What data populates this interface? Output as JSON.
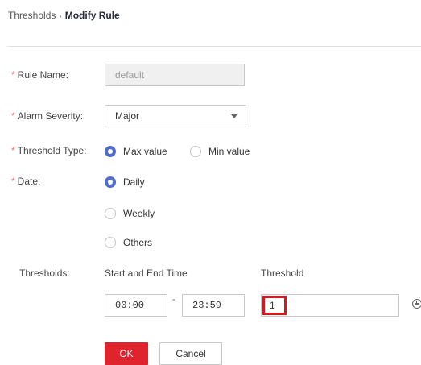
{
  "breadcrumb": {
    "parent": "Thresholds",
    "separator": "›",
    "current": "Modify Rule"
  },
  "form": {
    "rule_name": {
      "label": "Rule Name:",
      "value": "default"
    },
    "alarm_severity": {
      "label": "Alarm Severity:",
      "value": "Major"
    },
    "threshold_type": {
      "label": "Threshold Type:",
      "options": [
        "Max value",
        "Min value"
      ],
      "selected": "Max value"
    },
    "date": {
      "label": "Date:",
      "options": [
        "Daily",
        "Weekly",
        "Others"
      ],
      "selected": "Daily"
    },
    "thresholds": {
      "label": "Thresholds:",
      "col_time": "Start and End Time",
      "col_threshold": "Threshold",
      "start_time": "00:00",
      "dash": "-",
      "end_time": "23:59",
      "threshold_value": "1"
    }
  },
  "required_marker": "*",
  "buttons": {
    "ok": "OK",
    "cancel": "Cancel"
  },
  "colors": {
    "accent": "#526ecc",
    "primary_button": "#e0242e",
    "required": "#f66f6a",
    "highlight": "#e0141e"
  }
}
